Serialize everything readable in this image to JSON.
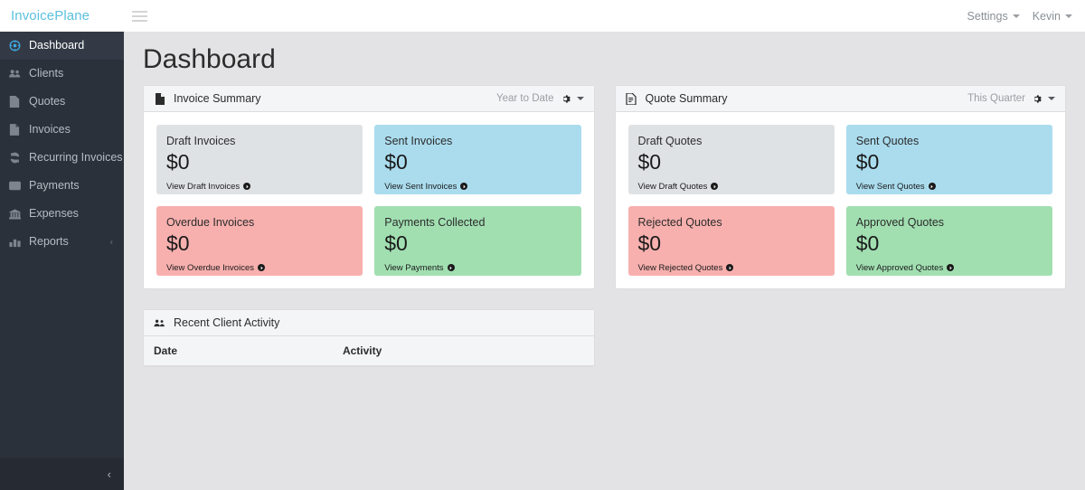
{
  "topbar": {
    "brand": "InvoicePlane",
    "menu_icon": "hamburger-icon",
    "settings_label": "Settings",
    "user_label": "Kevin"
  },
  "sidebar": {
    "items": [
      {
        "label": "Dashboard",
        "icon": "dashboard-icon",
        "active": true
      },
      {
        "label": "Clients",
        "icon": "clients-icon",
        "active": false
      },
      {
        "label": "Quotes",
        "icon": "quotes-icon",
        "active": false
      },
      {
        "label": "Invoices",
        "icon": "invoices-icon",
        "active": false
      },
      {
        "label": "Recurring Invoices",
        "icon": "recurring-invoices-icon",
        "active": false
      },
      {
        "label": "Payments",
        "icon": "payments-icon",
        "active": false
      },
      {
        "label": "Expenses",
        "icon": "expenses-icon",
        "active": false
      },
      {
        "label": "Reports",
        "icon": "reports-icon",
        "active": false,
        "sub_caret": "‹"
      }
    ],
    "collapse_icon": "‹"
  },
  "main": {
    "page_title": "Dashboard",
    "invoice_summary": {
      "title": "Invoice Summary",
      "icon": "invoice-file-icon",
      "period": "Year to Date",
      "gear_icon": "gear-icon",
      "cards": [
        {
          "label": "Draft Invoices",
          "amount": "$0",
          "link": "View Draft Invoices",
          "color": "gray",
          "hex": "#dfe2e5"
        },
        {
          "label": "Sent Invoices",
          "amount": "$0",
          "link": "View Sent Invoices",
          "color": "blue",
          "hex": "#aadcee"
        },
        {
          "label": "Overdue Invoices",
          "amount": "$0",
          "link": "View Overdue Invoices",
          "color": "pink",
          "hex": "#f7b0ae"
        },
        {
          "label": "Payments Collected",
          "amount": "$0",
          "link": "View Payments",
          "color": "green",
          "hex": "#a1dfb1"
        }
      ]
    },
    "quote_summary": {
      "title": "Quote Summary",
      "icon": "quote-file-icon",
      "period": "This Quarter",
      "gear_icon": "gear-icon",
      "cards": [
        {
          "label": "Draft Quotes",
          "amount": "$0",
          "link": "View Draft Quotes",
          "color": "gray",
          "hex": "#dfe2e5"
        },
        {
          "label": "Sent Quotes",
          "amount": "$0",
          "link": "View Sent Quotes",
          "color": "blue",
          "hex": "#aadcee"
        },
        {
          "label": "Rejected Quotes",
          "amount": "$0",
          "link": "View Rejected Quotes",
          "color": "pink",
          "hex": "#f7b0ae"
        },
        {
          "label": "Approved Quotes",
          "amount": "$0",
          "link": "View Approved Quotes",
          "color": "green",
          "hex": "#a1dfb1"
        }
      ]
    },
    "recent_activity": {
      "title": "Recent Client Activity",
      "icon": "users-icon",
      "columns": [
        "Date",
        "Activity"
      ],
      "rows": []
    }
  },
  "colors": {
    "brand": "#5bc0de",
    "sidebar_bg": "#2b313a",
    "sidebar_active_bg": "#333a45",
    "page_bg": "#e3e3e5",
    "panel_bg": "#ffffff",
    "panel_head_bg": "#f4f5f7"
  }
}
